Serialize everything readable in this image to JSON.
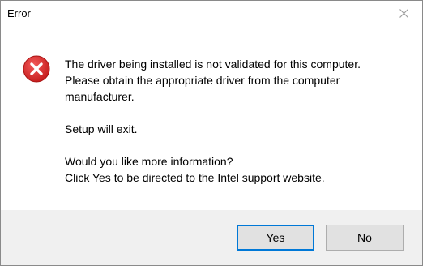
{
  "window": {
    "title": "Error"
  },
  "icons": {
    "close": "close-icon",
    "error": "error-icon"
  },
  "message": {
    "line1": "The driver being installed is not validated for this computer.",
    "line2": "Please obtain the appropriate driver from the computer",
    "line3": "manufacturer.",
    "line4": "Setup will exit.",
    "line5": "Would you like more information?",
    "line6": "Click Yes to be directed to the Intel support website."
  },
  "buttons": {
    "yes": "Yes",
    "no": "No"
  },
  "colors": {
    "error_red": "#e81123",
    "focus_border": "#0078d7",
    "footer_bg": "#f0f0f0"
  }
}
